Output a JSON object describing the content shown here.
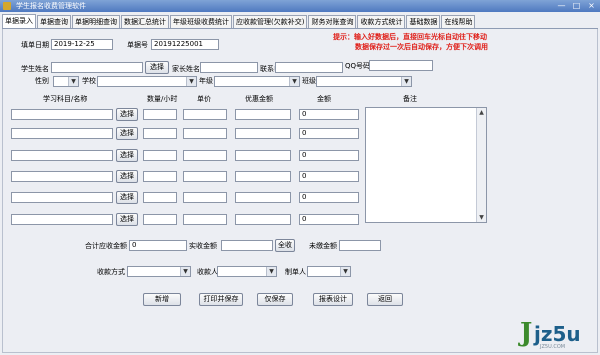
{
  "window": {
    "title": "学生报名收费管理软件",
    "min": "—",
    "max": "□",
    "close": "×"
  },
  "tabs": [
    "单据录入",
    "单据查询",
    "单据明细查询",
    "数据汇总统计",
    "年级班级收费统计",
    "应收款管理(欠款补交)",
    "财务对账查询",
    "收款方式统计",
    "基础数据",
    "在线帮助"
  ],
  "active_tab": 0,
  "form": {
    "date_label": "填单日期",
    "date_value": "2019-12-25",
    "bill_no_label": "单据号",
    "bill_no_value": "20191225001",
    "hint_line1": "提示：输入好数据后，直接回车光标自动往下移动",
    "hint_line2": "数据保存过一次后自动保存，方便下次调用",
    "student_name_label": "学生姓名",
    "student_name_value": "",
    "select_label": "选择",
    "parent_name_label": "家长姓名",
    "parent_name_value": "",
    "phone_label": "联系电话",
    "phone_value": "",
    "qq_label": "QQ号码",
    "qq_value": "",
    "gender_label": "性别",
    "school_label": "学校",
    "grade_label": "年级",
    "class_label": "班级"
  },
  "table": {
    "headers": {
      "subject": "学习科目/名称",
      "qty": "数量/小时",
      "price": "单价",
      "discount": "优惠金额",
      "amount": "金额",
      "remark": "备注"
    },
    "rows": [
      {
        "subject": "",
        "qty": "",
        "price": "",
        "discount": "",
        "amount": "0"
      },
      {
        "subject": "",
        "qty": "",
        "price": "",
        "discount": "",
        "amount": "0"
      },
      {
        "subject": "",
        "qty": "",
        "price": "",
        "discount": "",
        "amount": "0"
      },
      {
        "subject": "",
        "qty": "",
        "price": "",
        "discount": "",
        "amount": "0"
      },
      {
        "subject": "",
        "qty": "",
        "price": "",
        "discount": "",
        "amount": "0"
      },
      {
        "subject": "",
        "qty": "",
        "price": "",
        "discount": "",
        "amount": "0"
      }
    ]
  },
  "totals": {
    "receivable_label": "合计应收金额",
    "receivable_value": "0",
    "received_label": "实收金额",
    "received_value": "",
    "full_pay_label": "全收",
    "owed_label": "未缴金额",
    "owed_value": ""
  },
  "payment": {
    "method_label": "收款方式",
    "payee_label": "收款人",
    "creator_label": "制单人"
  },
  "actions": [
    "新增",
    "打印并保存",
    "仅保存",
    "报表设计",
    "返回"
  ],
  "watermark": {
    "mark": "J",
    "word": "jz5u",
    "url": "JZ5U.COM"
  }
}
